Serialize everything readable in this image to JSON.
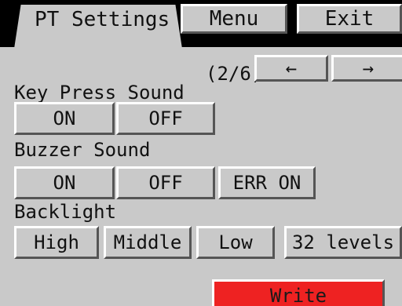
{
  "tabs": {
    "active_label": "PT Settings",
    "menu_label": "Menu",
    "exit_label": "Exit"
  },
  "pager": {
    "page_indicator": "(2/6)",
    "prev_label": "←",
    "next_label": "→"
  },
  "key_press_sound": {
    "label": "Key Press Sound",
    "on_label": "ON",
    "off_label": "OFF"
  },
  "buzzer_sound": {
    "label": "Buzzer Sound",
    "on_label": "ON",
    "off_label": "OFF",
    "err_on_label": "ERR ON"
  },
  "backlight": {
    "label": "Backlight",
    "high_label": "High",
    "middle_label": "Middle",
    "low_label": "Low",
    "levels_label": "32 levels"
  },
  "write_label": "Write",
  "colors": {
    "background": "#c9c9c9",
    "tab_bar": "#000000",
    "write_button": "#ee2222"
  }
}
